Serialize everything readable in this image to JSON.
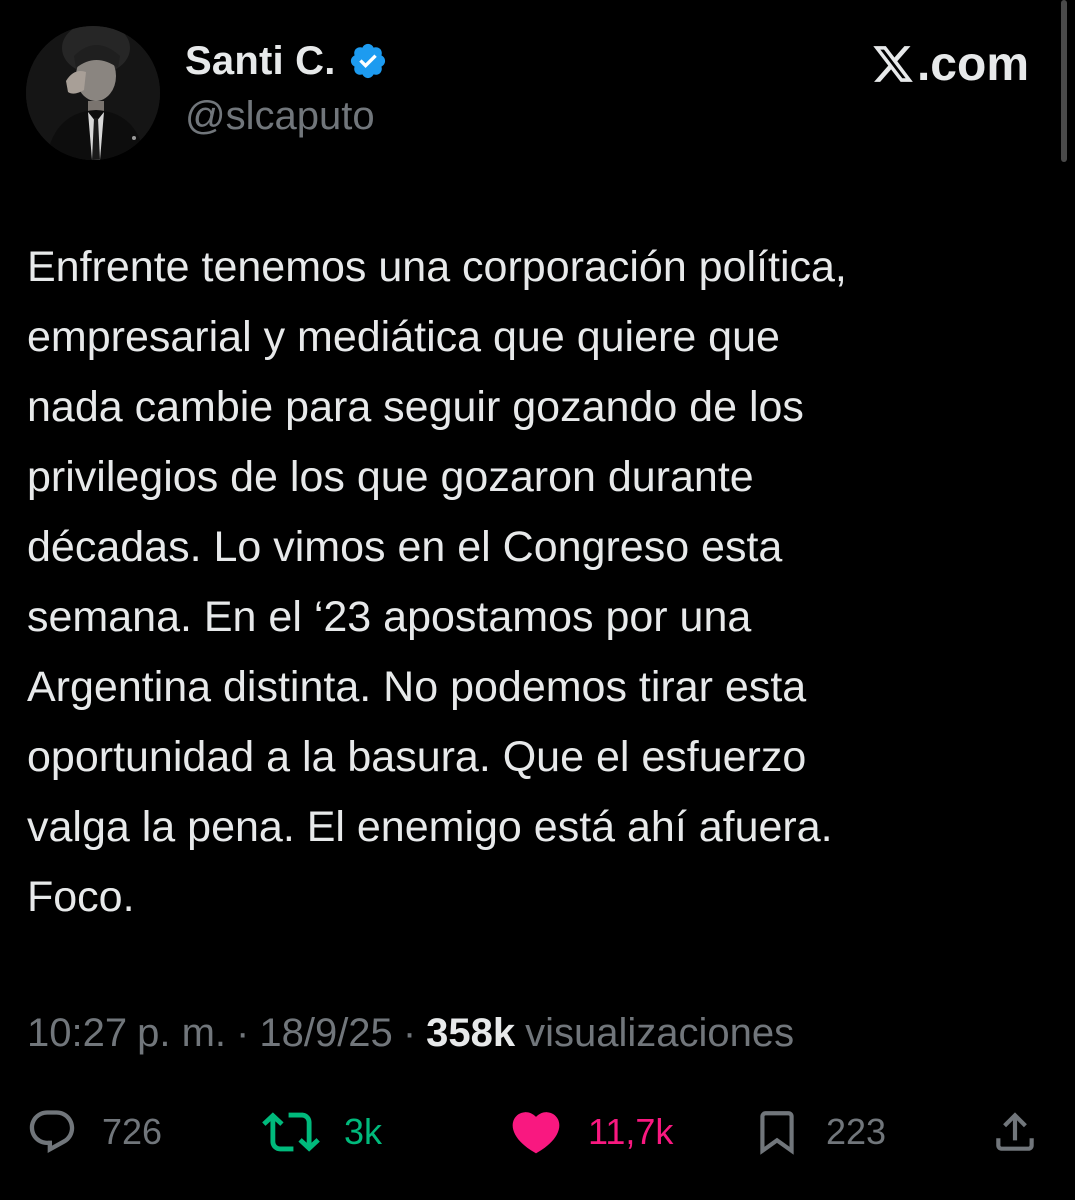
{
  "author": {
    "display_name": "Santi C.",
    "handle": "@slcaputo",
    "verified": true,
    "avatar": "profile-photo"
  },
  "brand": {
    "label": ".com",
    "logo_icon": "x-logo-icon"
  },
  "tweet": {
    "text": "Enfrente tenemos una corporación política,\nempresarial y mediática que quiere que\nnada cambie para seguir gozando de los\nprivilegios de los que gozaron durante\ndécadas. Lo vimos en el Congreso esta\nsemana. En el ‘23 apostamos por una\nArgentina distinta. No podemos tirar esta\noportunidad a la basura. Que el esfuerzo\nvalga la pena. El enemigo está ahí afuera.\nFoco."
  },
  "meta": {
    "time": "10:27",
    "ampm": "p. m.",
    "separator": "·",
    "date": "18/9/25",
    "views_count": "358k",
    "views_label": "visualizaciones"
  },
  "actions": {
    "replies": "726",
    "reposts": "3k",
    "likes": "11,7k",
    "bookmarks": "223"
  },
  "colors": {
    "background": "#000000",
    "text_primary": "#e7e9ea",
    "text_secondary": "#71767b",
    "verified_blue": "#1d9bf0",
    "repost_green": "#00ba7c",
    "like_pink": "#f91880"
  },
  "icons": {
    "verified": "verified-badge-icon",
    "reply": "reply-bubble-icon",
    "repost": "repost-icon",
    "like": "heart-filled-icon",
    "bookmark": "bookmark-icon",
    "share": "share-icon"
  }
}
